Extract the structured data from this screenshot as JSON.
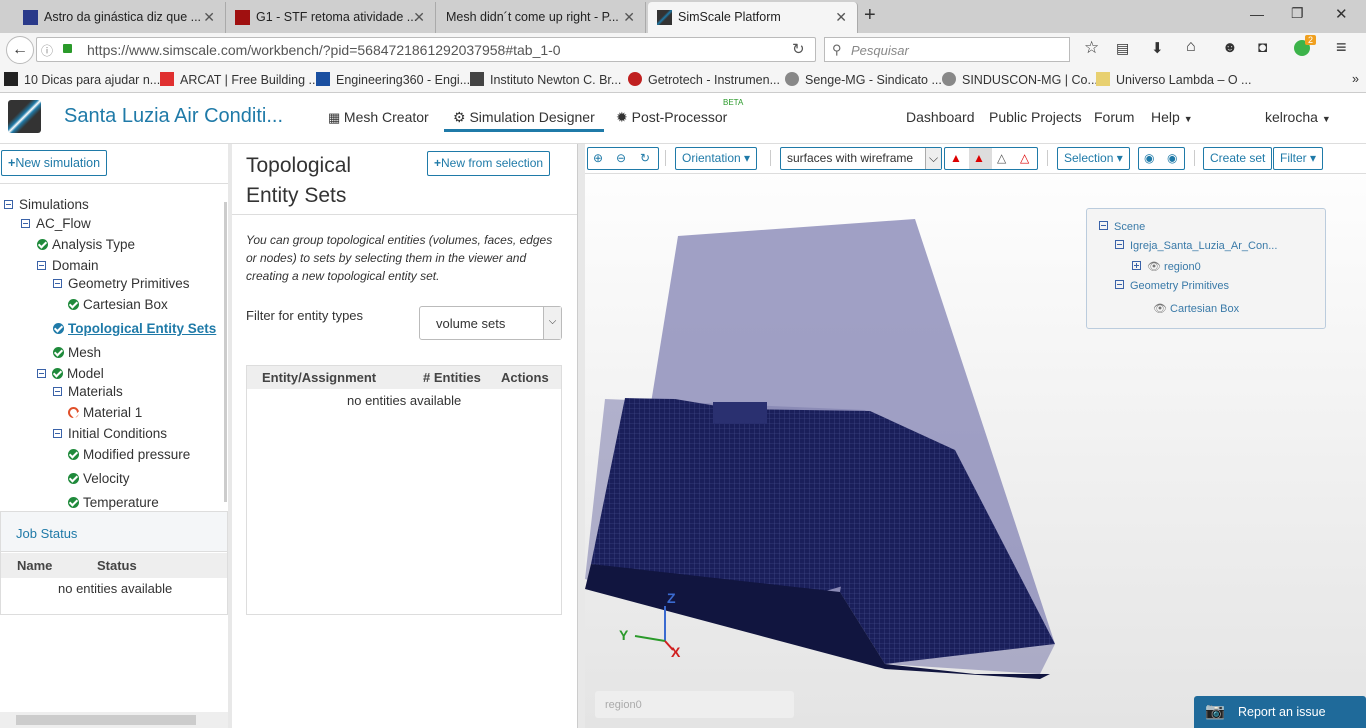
{
  "browser": {
    "tabs": [
      {
        "label": "Astro da ginástica diz que ..."
      },
      {
        "label": "G1 - STF retoma atividade ..."
      },
      {
        "label": "Mesh didn´t come up right - P..."
      },
      {
        "label": "SimScale Platform"
      }
    ],
    "url": "https://www.simscale.com/workbench/?pid=5684721861292037958#tab_1-0",
    "search_placeholder": "Pesquisar",
    "badge": "2",
    "bookmarks": [
      "10 Dicas para ajudar n...",
      "ARCAT | Free Building ...",
      "Engineering360 - Engi...",
      "Instituto Newton C. Br...",
      "Getrotech - Instrumen...",
      "Senge-MG - Sindicato ...",
      "SINDUSCON-MG | Co...",
      "Universo Lambda – O ..."
    ]
  },
  "app": {
    "project_title": "Santa Luzia Air Conditi...",
    "nav": {
      "mesh": "Mesh Creator",
      "sim": "Simulation Designer",
      "post": "Post-Processor",
      "beta": "BETA"
    },
    "right_nav": [
      "Dashboard",
      "Public Projects",
      "Forum",
      "Help"
    ],
    "user": "kelrocha",
    "accent": "#1f7aa8"
  },
  "left": {
    "new_sim": "New simulation",
    "tree": [
      "Simulations",
      "AC_Flow",
      "Analysis Type",
      "Domain",
      "Geometry Primitives",
      "Cartesian Box",
      "Topological Entity Sets",
      "Mesh",
      "Model",
      "Materials",
      "Material 1",
      "Initial Conditions",
      "Modified pressure",
      "Velocity",
      "Temperature"
    ],
    "job_status": {
      "title": "Job Status",
      "cols": [
        "Name",
        "Status"
      ],
      "empty": "no entities available"
    }
  },
  "middle": {
    "title_line1": "Topological",
    "title_line2": "Entity Sets",
    "new_from_sel": "New from selection",
    "description": "You can group topological entities (volumes, faces, edges or nodes) to sets by selecting them in the viewer and creating a new topological entity set.",
    "filter_label": "Filter for entity types",
    "filter_value": "volume sets",
    "table": {
      "cols": [
        "Entity/Assignment",
        "# Entities",
        "Actions"
      ],
      "empty": "no entities available"
    }
  },
  "viewer": {
    "orientation": "Orientation",
    "render_mode": "surfaces with wireframe",
    "selection": "Selection",
    "create_set": "Create set",
    "filter": "Filter",
    "scene": [
      "Scene",
      "Igreja_Santa_Luzia_Ar_Con...",
      "region0",
      "Geometry Primitives",
      "Cartesian Box"
    ],
    "axes": {
      "x": "X",
      "y": "Y",
      "z": "Z"
    },
    "status": "region0",
    "report": "Report an issue"
  }
}
